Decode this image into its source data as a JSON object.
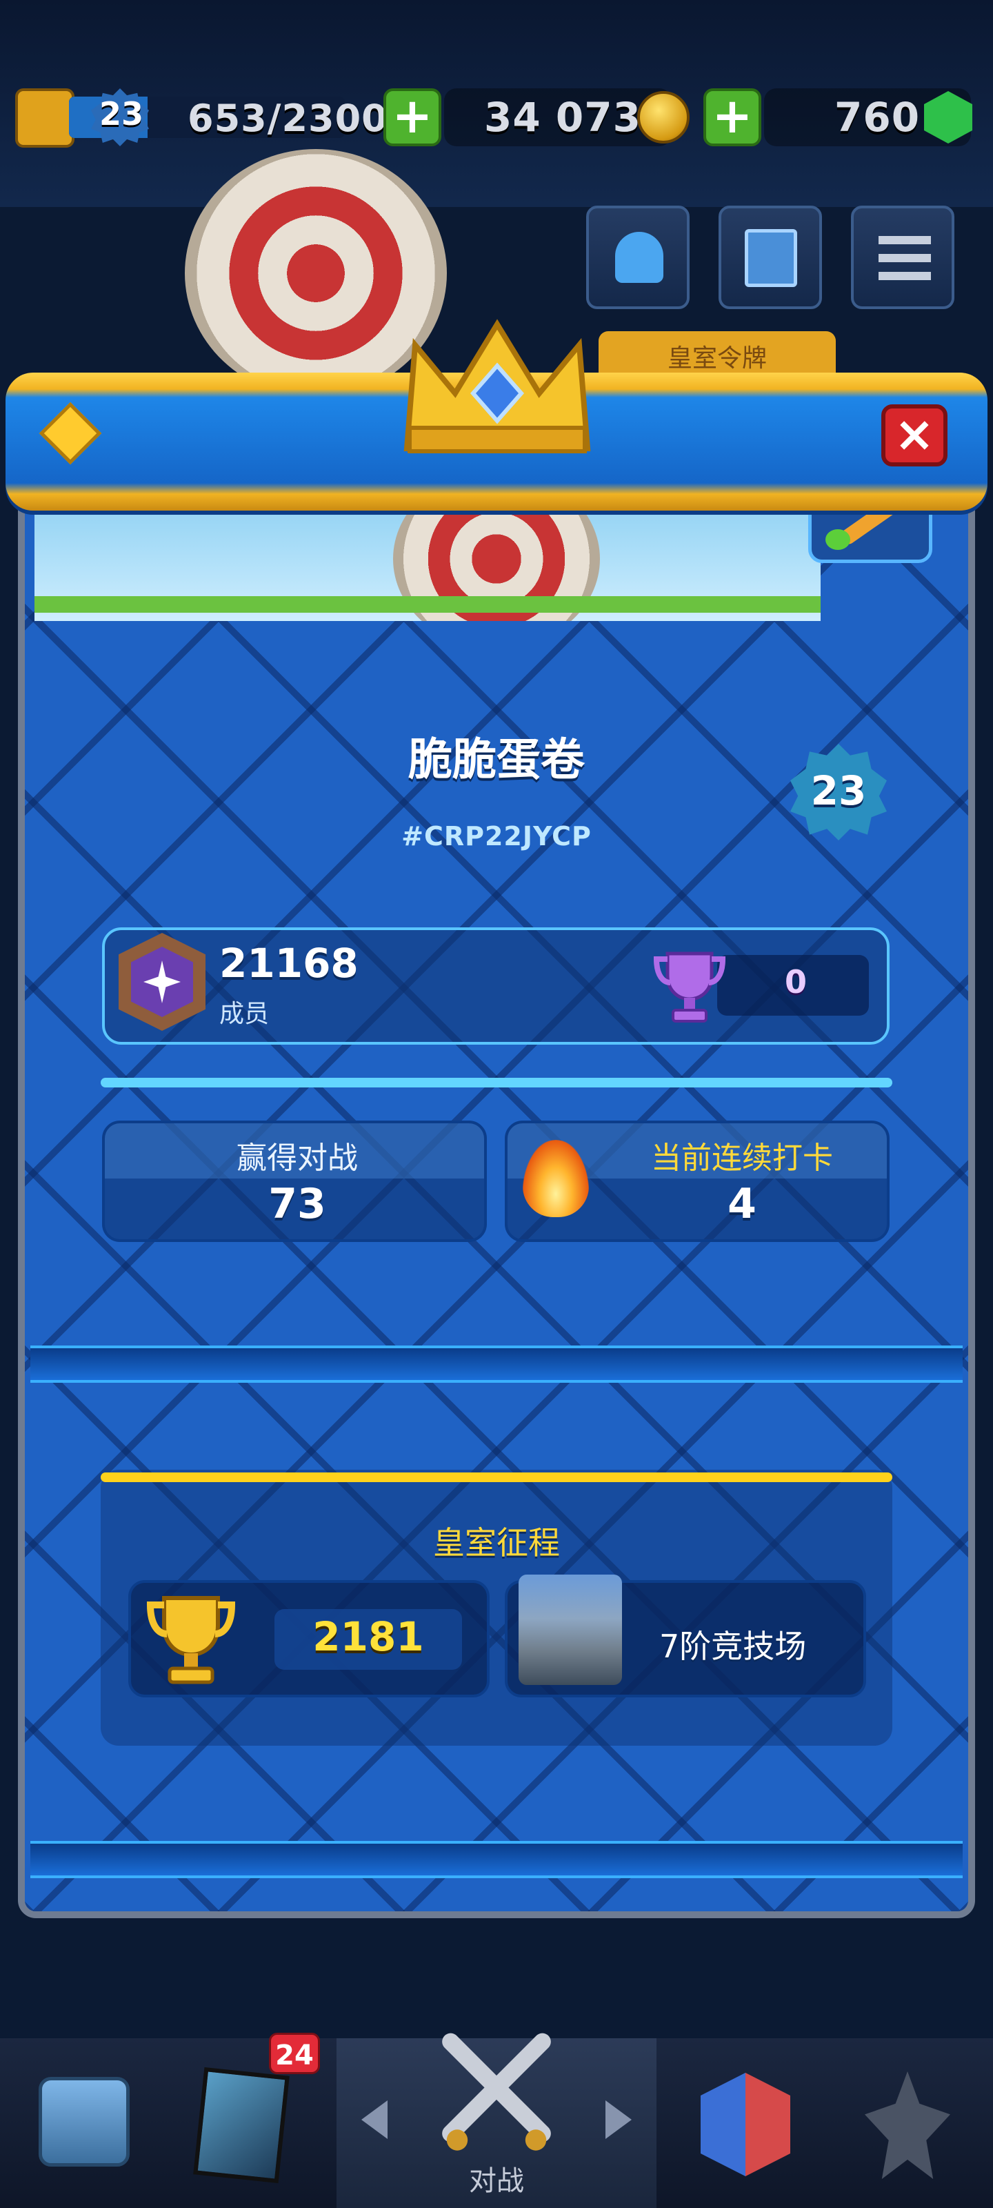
{
  "topbar": {
    "level": "23",
    "xp": "653/2300",
    "xp_fraction": 0.284,
    "gold": "34 073",
    "gems": "760",
    "royal_tab": "皇室令牌"
  },
  "modal": {
    "player_name": "脆脆蛋卷",
    "player_tag": "#CRP22JYCP",
    "level": "23",
    "clan_number": "21168",
    "clan_role": "成员",
    "trophy_count": "0",
    "stats": {
      "wins_label": "赢得对战",
      "wins_value": "73",
      "streak_label": "当前连续打卡",
      "streak_value": "4"
    },
    "royal_road": {
      "title": "皇室征程",
      "trophies": "2181",
      "arena": "7阶竞技场"
    }
  },
  "bottom_nav": {
    "cards_badge": "24",
    "battle_label": "对战"
  },
  "colors": {
    "modal_blue": "#1f62c4",
    "gold": "#ffd21c",
    "close_red": "#d8262b",
    "accent_cyan": "#63d5ff"
  },
  "icons": [
    "king-tower-icon",
    "plus-icon",
    "coin-icon",
    "gem-icon",
    "friends-icon",
    "news-icon",
    "menu-icon",
    "crown-icon",
    "diamond-icon",
    "close-icon",
    "brush-icon",
    "clan-badge-icon",
    "purple-trophy-icon",
    "fire-icon",
    "gold-trophy-icon",
    "arena-icon",
    "chest-icon",
    "cards-icon",
    "swords-icon",
    "clan-wars-icon",
    "tournament-icon"
  ]
}
